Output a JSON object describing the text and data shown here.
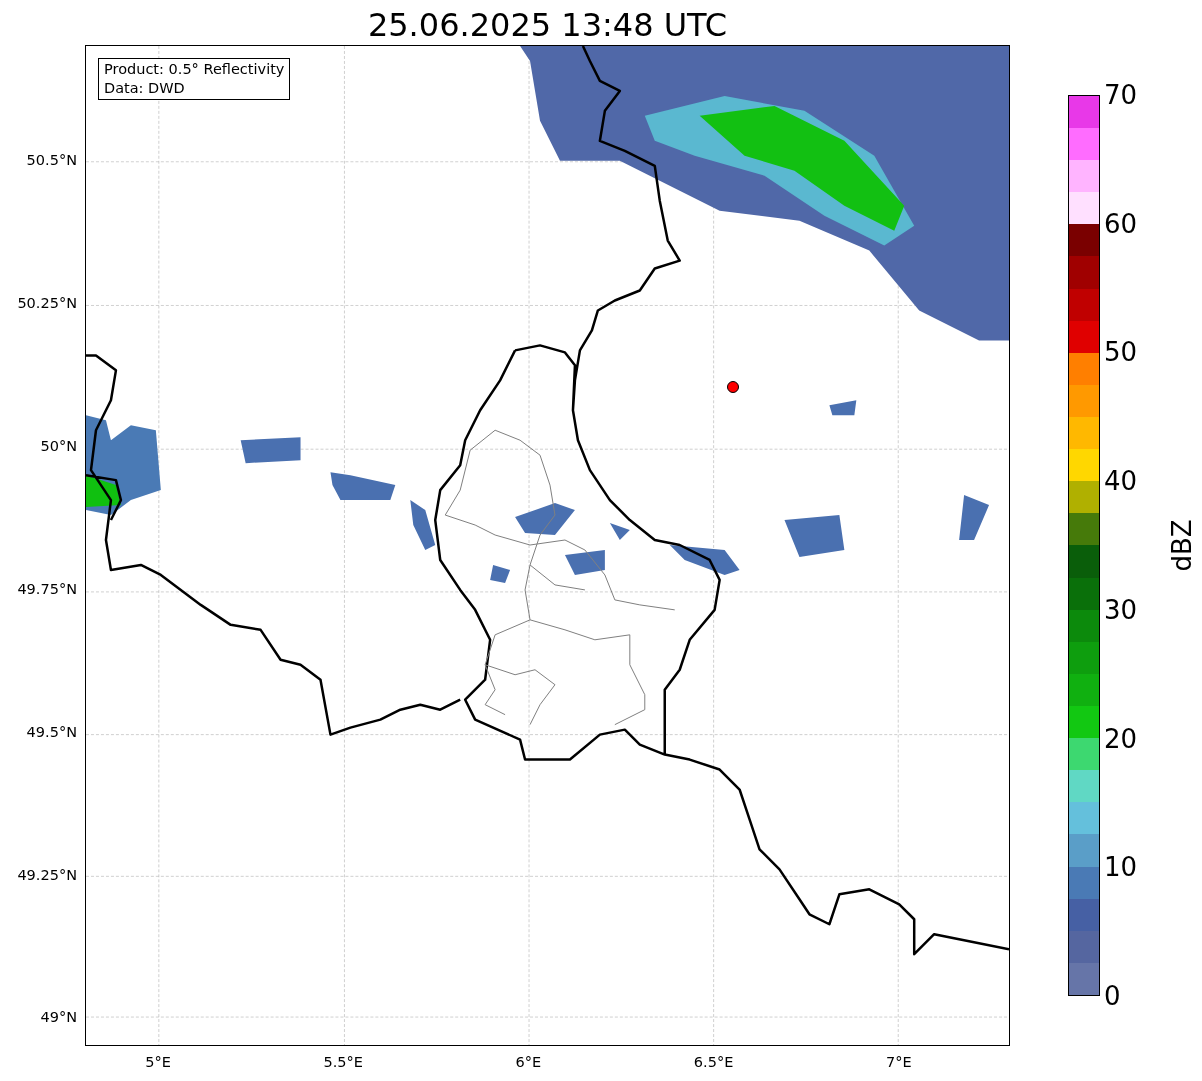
{
  "title": "25.06.2025 13:48 UTC",
  "map": {
    "info_box": [
      "Product: 0.5° Reflectivity",
      "Data: DWD"
    ],
    "yticks": [
      "50.5°N",
      "50.25°N",
      "50°N",
      "49.75°N",
      "49.5°N",
      "49.25°N",
      "49°N"
    ],
    "xticks": [
      "5°E",
      "5.5°E",
      "6°E",
      "6.5°E",
      "7°E"
    ]
  },
  "colorbar": {
    "label": "dBZ",
    "ticks": [
      "70",
      "60",
      "50",
      "40",
      "30",
      "20",
      "10",
      "0"
    ],
    "bins": [
      {
        "color": "#6675a8"
      },
      {
        "color": "#5566a0"
      },
      {
        "color": "#4660a4"
      },
      {
        "color": "#4a7ab5"
      },
      {
        "color": "#5a9ec8"
      },
      {
        "color": "#64c0dc"
      },
      {
        "color": "#60d8c4"
      },
      {
        "color": "#3dd870"
      },
      {
        "color": "#12c812"
      },
      {
        "color": "#10b010"
      },
      {
        "color": "#0e9e0e"
      },
      {
        "color": "#0c8a0c"
      },
      {
        "color": "#0a700a"
      },
      {
        "color": "#0a5e0a"
      },
      {
        "color": "#467a0a"
      },
      {
        "color": "#b0b000"
      },
      {
        "color": "#ffd700"
      },
      {
        "color": "#ffb800"
      },
      {
        "color": "#ff9900"
      },
      {
        "color": "#ff7f00"
      },
      {
        "color": "#e00000"
      },
      {
        "color": "#c00000"
      },
      {
        "color": "#a00000"
      },
      {
        "color": "#7a0000"
      },
      {
        "color": "#ffe0ff"
      },
      {
        "color": "#ffb4ff"
      },
      {
        "color": "#ff6cff"
      },
      {
        "color": "#e838e8"
      }
    ]
  }
}
